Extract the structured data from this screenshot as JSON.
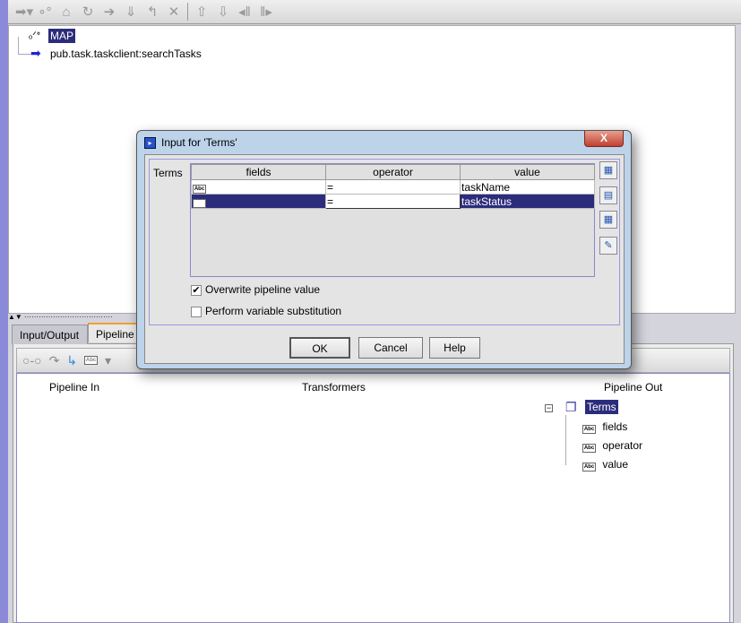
{
  "flow_tree": {
    "map_label": "MAP",
    "invoke_label": "pub.task.taskclient:searchTasks"
  },
  "tabs": [
    {
      "label": "Input/Output"
    },
    {
      "label": "Pipeline"
    }
  ],
  "pipeline": {
    "in_header": "Pipeline In",
    "transformers_header": "Transformers",
    "out_header": "Pipeline Out",
    "out_tree": {
      "root": "Terms",
      "children": [
        "fields",
        "operator",
        "value"
      ]
    }
  },
  "dialog": {
    "title": "Input for 'Terms'",
    "field_label": "Terms",
    "columns": [
      "fields",
      "operator",
      "value"
    ],
    "rows": [
      {
        "fields": "",
        "operator": "=",
        "value": "taskName"
      },
      {
        "fields": "",
        "operator": "=",
        "value": "taskStatus"
      }
    ],
    "overwrite_label": "Overwrite pipeline value",
    "overwrite_checked": true,
    "substitution_label": "Perform variable substitution",
    "substitution_checked": false,
    "ok": "OK",
    "cancel": "Cancel",
    "help": "Help",
    "close": "X",
    "check_mark": "✔"
  }
}
